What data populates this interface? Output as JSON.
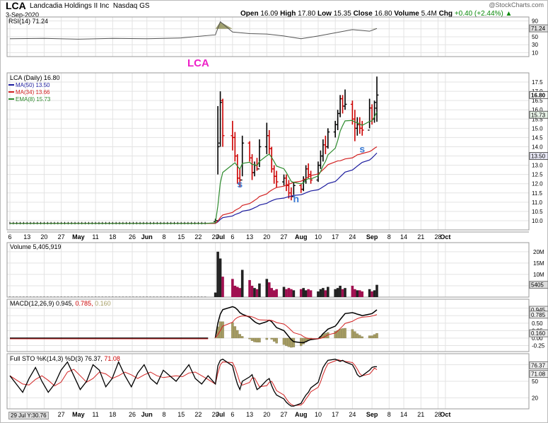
{
  "header": {
    "symbol": "LCA",
    "company": "Landcadia Holdings II Inc",
    "exchange": "Nasdaq GS",
    "date": "3-Sep-2020",
    "watermark": "@StockCharts.com",
    "open_label": "Open",
    "open": "16.09",
    "high_label": "High",
    "high": "17.80",
    "low_label": "Low",
    "low": "15.35",
    "close_label": "Close",
    "close": "16.80",
    "volume_label": "Volume",
    "volume": "5.4M",
    "chg_label": "Chg",
    "chg": "+0.40 (+2.44%)",
    "chg_arrow": "▲"
  },
  "cursor_readout": "29 Jul Y:30.76",
  "colors": {
    "up_bar": "#000000",
    "down_bar": "#cc0000",
    "ma50": "#1b1b9e",
    "ma34": "#d22222",
    "ema8": "#2e8b2e",
    "rsi_fill": "#88884a",
    "macd_hist": "#a59c62",
    "volume_up": "#222222",
    "volume_down": "#a01050",
    "annotation_s": "#3a7bd5",
    "annotation_title": "#ee20c8"
  },
  "chart_data": [
    {
      "type": "line",
      "panel": "rsi",
      "title": "RSI(14) 71.24",
      "y_ticks": [
        90,
        70,
        50,
        30,
        10
      ],
      "ylim": [
        0,
        100
      ],
      "last_value": "71.24",
      "x": [
        "Apr-06",
        "Apr-20",
        "May-04",
        "May-18",
        "Jun-01",
        "Jun-15",
        "Jun-29",
        "Jul-01",
        "Jul-06",
        "Jul-13",
        "Jul-20",
        "Jul-27",
        "Aug-03",
        "Aug-10",
        "Aug-17",
        "Aug-24",
        "Aug-31",
        "Sep-03"
      ],
      "series": [
        {
          "values": [
            45,
            46,
            44,
            46,
            45,
            47,
            55,
            88,
            62,
            58,
            57,
            52,
            45,
            52,
            60,
            68,
            64,
            71
          ]
        }
      ]
    },
    {
      "type": "line",
      "panel": "price",
      "title": "LCA (Daily) 16.80",
      "annotation_title": "LCA",
      "annotations": [
        {
          "text": "s",
          "x": "Jul-09",
          "y": 11.8
        },
        {
          "text": "h",
          "x": "Aug-01",
          "y": 11.0
        },
        {
          "text": "s",
          "x": "Aug-28",
          "y": 13.7
        }
      ],
      "legend": [
        {
          "name": "MA(50) 13.50",
          "color": "#1b1b9e"
        },
        {
          "name": "MA(34) 13.66",
          "color": "#d22222"
        },
        {
          "name": "EMA(8) 15.73",
          "color": "#2e8b2e"
        }
      ],
      "y_ticks": [
        10.0,
        10.5,
        11.0,
        11.5,
        12.0,
        12.5,
        13.0,
        13.5,
        14.0,
        14.5,
        15.0,
        15.5,
        16.0,
        16.5,
        17.0,
        17.5
      ],
      "value_tags": [
        "16.80",
        "15.73",
        "13.50"
      ],
      "ylim": [
        9.5,
        18.0
      ],
      "x_ticks": [
        "6",
        "13",
        "20",
        "27",
        "May",
        "11",
        "18",
        "26",
        "Jun",
        "8",
        "15",
        "22",
        "29",
        "Jul",
        "6",
        "13",
        "20",
        "27",
        "Aug",
        "10",
        "17",
        "24",
        "Sep",
        "8",
        "14",
        "21",
        "28",
        "Oct"
      ],
      "candles_pre": {
        "dates": "Apr-06 to Jun-26",
        "price": 9.85
      },
      "candles": [
        {
          "d": "Jun-29",
          "o": 9.95,
          "h": 10.1,
          "l": 9.9,
          "c": 10.0
        },
        {
          "d": "Jun-30",
          "o": 10.0,
          "h": 16.2,
          "l": 12.5,
          "c": 14.0
        },
        {
          "d": "Jul-01",
          "o": 14.2,
          "h": 17.0,
          "l": 14.0,
          "c": 16.4
        },
        {
          "d": "Jul-02",
          "o": 16.5,
          "h": 16.6,
          "l": 14.0,
          "c": 14.6
        },
        {
          "d": "Jul-06",
          "o": 14.6,
          "h": 15.4,
          "l": 13.8,
          "c": 14.5
        },
        {
          "d": "Jul-07",
          "o": 14.5,
          "h": 14.8,
          "l": 13.2,
          "c": 13.5
        },
        {
          "d": "Jul-08",
          "o": 13.5,
          "h": 13.6,
          "l": 12.0,
          "c": 12.3
        },
        {
          "d": "Jul-09",
          "o": 12.3,
          "h": 12.8,
          "l": 11.8,
          "c": 12.2
        },
        {
          "d": "Jul-10",
          "o": 12.2,
          "h": 14.6,
          "l": 12.4,
          "c": 14.2
        },
        {
          "d": "Jul-13",
          "o": 14.2,
          "h": 14.3,
          "l": 13.2,
          "c": 13.4
        },
        {
          "d": "Jul-14",
          "o": 13.4,
          "h": 13.6,
          "l": 12.2,
          "c": 12.6
        },
        {
          "d": "Jul-15",
          "o": 12.6,
          "h": 13.2,
          "l": 12.4,
          "c": 13.0
        },
        {
          "d": "Jul-16",
          "o": 13.0,
          "h": 13.4,
          "l": 12.7,
          "c": 12.8
        },
        {
          "d": "Jul-17",
          "o": 12.8,
          "h": 14.4,
          "l": 12.9,
          "c": 14.0
        },
        {
          "d": "Jul-20",
          "o": 14.0,
          "h": 15.3,
          "l": 13.6,
          "c": 14.6
        },
        {
          "d": "Jul-21",
          "o": 14.6,
          "h": 14.9,
          "l": 13.6,
          "c": 13.9
        },
        {
          "d": "Jul-22",
          "o": 13.9,
          "h": 14.0,
          "l": 12.6,
          "c": 12.8
        },
        {
          "d": "Jul-23",
          "o": 12.8,
          "h": 13.0,
          "l": 12.0,
          "c": 12.4
        },
        {
          "d": "Jul-24",
          "o": 12.4,
          "h": 12.7,
          "l": 11.8,
          "c": 12.1
        },
        {
          "d": "Jul-27",
          "o": 12.1,
          "h": 12.5,
          "l": 11.9,
          "c": 12.3
        },
        {
          "d": "Jul-28",
          "o": 12.3,
          "h": 12.5,
          "l": 11.6,
          "c": 11.9
        },
        {
          "d": "Jul-29",
          "o": 11.9,
          "h": 12.2,
          "l": 11.2,
          "c": 11.5
        },
        {
          "d": "Jul-30",
          "o": 11.5,
          "h": 11.8,
          "l": 11.1,
          "c": 11.3
        },
        {
          "d": "Jul-31",
          "o": 11.3,
          "h": 12.1,
          "l": 11.4,
          "c": 11.9
        },
        {
          "d": "Aug-03",
          "o": 11.9,
          "h": 12.0,
          "l": 11.5,
          "c": 11.7
        },
        {
          "d": "Aug-04",
          "o": 11.7,
          "h": 12.4,
          "l": 11.6,
          "c": 12.2
        },
        {
          "d": "Aug-05",
          "o": 12.2,
          "h": 13.0,
          "l": 12.0,
          "c": 12.8
        },
        {
          "d": "Aug-06",
          "o": 12.8,
          "h": 13.1,
          "l": 12.3,
          "c": 12.5
        },
        {
          "d": "Aug-07",
          "o": 12.5,
          "h": 12.7,
          "l": 12.0,
          "c": 12.2
        },
        {
          "d": "Aug-10",
          "o": 12.2,
          "h": 13.2,
          "l": 12.1,
          "c": 13.0
        },
        {
          "d": "Aug-11",
          "o": 13.0,
          "h": 13.8,
          "l": 12.8,
          "c": 13.5
        },
        {
          "d": "Aug-12",
          "o": 13.5,
          "h": 14.4,
          "l": 13.2,
          "c": 14.1
        },
        {
          "d": "Aug-13",
          "o": 14.1,
          "h": 14.6,
          "l": 13.6,
          "c": 14.0
        },
        {
          "d": "Aug-14",
          "o": 14.0,
          "h": 15.0,
          "l": 13.9,
          "c": 14.8
        },
        {
          "d": "Aug-17",
          "o": 14.8,
          "h": 15.4,
          "l": 14.5,
          "c": 15.2
        },
        {
          "d": "Aug-18",
          "o": 15.2,
          "h": 16.0,
          "l": 14.9,
          "c": 15.8
        },
        {
          "d": "Aug-19",
          "o": 15.8,
          "h": 16.8,
          "l": 15.6,
          "c": 16.6
        },
        {
          "d": "Aug-20",
          "o": 16.6,
          "h": 16.8,
          "l": 15.8,
          "c": 16.2
        },
        {
          "d": "Aug-21",
          "o": 16.2,
          "h": 17.1,
          "l": 16.0,
          "c": 16.3
        },
        {
          "d": "Aug-24",
          "o": 16.3,
          "h": 16.5,
          "l": 15.2,
          "c": 15.5
        },
        {
          "d": "Aug-25",
          "o": 15.5,
          "h": 16.0,
          "l": 14.3,
          "c": 15.0
        },
        {
          "d": "Aug-26",
          "o": 15.0,
          "h": 15.6,
          "l": 14.6,
          "c": 15.2
        },
        {
          "d": "Aug-27",
          "o": 15.2,
          "h": 15.6,
          "l": 14.7,
          "c": 15.0
        },
        {
          "d": "Aug-28",
          "o": 15.0,
          "h": 15.4,
          "l": 14.6,
          "c": 14.9
        },
        {
          "d": "Aug-31",
          "o": 14.9,
          "h": 16.6,
          "l": 15.0,
          "c": 16.1
        },
        {
          "d": "Sep-01",
          "o": 16.1,
          "h": 16.3,
          "l": 15.2,
          "c": 15.5
        },
        {
          "d": "Sep-02",
          "o": 15.5,
          "h": 16.5,
          "l": 15.3,
          "c": 16.4
        },
        {
          "d": "Sep-03",
          "o": 16.09,
          "h": 17.8,
          "l": 15.35,
          "c": 16.8
        }
      ]
    },
    {
      "type": "bar",
      "panel": "volume",
      "title": "Volume 5,405,919",
      "y_ticks": [
        "20M",
        "15M",
        "10M",
        "5M"
      ],
      "value_tag": "5405",
      "ylim": [
        0,
        24000000
      ],
      "pre_volume": 150000,
      "values": [
        2000000,
        20000000,
        17000000,
        9000000,
        8000000,
        5000000,
        4500000,
        4000000,
        12000000,
        7500000,
        5000000,
        4000000,
        3500000,
        6000000,
        8000000,
        6500000,
        4000000,
        3000000,
        3500000,
        4500000,
        3500000,
        4000000,
        3500000,
        3000000,
        3500000,
        4000000,
        3000000,
        3500000,
        3000000,
        2500000,
        3500000,
        4000000,
        3000000,
        4500000,
        3500000,
        4000000,
        5000000,
        3500000,
        4000000,
        5000000,
        3500000,
        3000000,
        3000000,
        2500000,
        3500000,
        2500000,
        3000000,
        5400000
      ]
    },
    {
      "type": "line",
      "panel": "macd",
      "title": "MACD(12,26,9) 0.945, 0.785, 0.160",
      "y_ticks": [
        "1.00",
        "0.75",
        "0.50",
        "0.25",
        "0.00",
        "-0.25"
      ],
      "value_tags": [
        "0.945",
        "0.785",
        "0.160"
      ],
      "ylim": [
        -0.45,
        1.3
      ],
      "series": [
        {
          "name": "MACD",
          "values": [
            0.02,
            0.5,
            0.8,
            0.95,
            1.05,
            1.02,
            0.95,
            0.85,
            0.8,
            0.7,
            0.62,
            0.55,
            0.5,
            0.47,
            0.55,
            0.6,
            0.55,
            0.45,
            0.35,
            0.25,
            0.15,
            0.05,
            -0.05,
            -0.12,
            -0.15,
            -0.15,
            -0.12,
            -0.08,
            -0.05,
            -0.02,
            0.05,
            0.15,
            0.22,
            0.3,
            0.4,
            0.5,
            0.62,
            0.72,
            0.82,
            0.85,
            0.83,
            0.8,
            0.78,
            0.75,
            0.8,
            0.82,
            0.88,
            0.945
          ]
        },
        {
          "name": "Signal",
          "values": [
            0.01,
            0.12,
            0.25,
            0.4,
            0.53,
            0.63,
            0.69,
            0.72,
            0.74,
            0.73,
            0.71,
            0.68,
            0.64,
            0.61,
            0.6,
            0.6,
            0.59,
            0.56,
            0.52,
            0.47,
            0.41,
            0.34,
            0.26,
            0.18,
            0.11,
            0.05,
            0.01,
            -0.01,
            -0.02,
            -0.02,
            -0.01,
            0.02,
            0.06,
            0.11,
            0.17,
            0.24,
            0.32,
            0.4,
            0.49,
            0.56,
            0.61,
            0.65,
            0.68,
            0.7,
            0.72,
            0.74,
            0.76,
            0.785
          ]
        }
      ]
    },
    {
      "type": "line",
      "panel": "stochastic",
      "title": "Full STO %K(14,3) %D(3) 76.37, 71.08",
      "y_ticks": [
        "80",
        "50",
        "20"
      ],
      "value_tags": [
        "76.37",
        "71.08"
      ],
      "ylim": [
        0,
        100
      ],
      "pre_k": [
        60,
        45,
        30,
        55,
        75,
        50,
        30,
        45,
        70,
        85,
        60,
        35,
        50,
        80,
        70,
        40,
        55,
        85,
        60,
        40,
        65,
        80,
        55,
        45,
        70,
        60,
        50,
        65,
        80,
        55,
        45,
        60
      ],
      "series": [
        {
          "name": "%K",
          "values": [
            45,
            78,
            88,
            90,
            78,
            60,
            45,
            35,
            50,
            58,
            62,
            48,
            35,
            38,
            52,
            55,
            42,
            32,
            25,
            18,
            12,
            8,
            5,
            5,
            10,
            18,
            25,
            30,
            38,
            48,
            62,
            75,
            82,
            88,
            90,
            88,
            86,
            88,
            85,
            80,
            72,
            62,
            58,
            60,
            70,
            75,
            76.37,
            76.37
          ]
        },
        {
          "name": "%D",
          "values": [
            45,
            65,
            80,
            85,
            84,
            75,
            62,
            48,
            43,
            48,
            56,
            56,
            48,
            40,
            42,
            48,
            50,
            42,
            33,
            25,
            18,
            12,
            8,
            6,
            7,
            11,
            18,
            24,
            31,
            39,
            49,
            62,
            73,
            82,
            87,
            89,
            88,
            87,
            86,
            84,
            79,
            72,
            64,
            60,
            63,
            68,
            74,
            71.08
          ]
        }
      ]
    }
  ],
  "x_axis": {
    "labels": [
      {
        "t": "6",
        "d": "Apr-06"
      },
      {
        "t": "13",
        "d": "Apr-13"
      },
      {
        "t": "20",
        "d": "Apr-20"
      },
      {
        "t": "27",
        "d": "Apr-27"
      },
      {
        "t": "May",
        "d": "May-04",
        "b": true
      },
      {
        "t": "11",
        "d": "May-11"
      },
      {
        "t": "18",
        "d": "May-18"
      },
      {
        "t": "26",
        "d": "May-26"
      },
      {
        "t": "Jun",
        "d": "Jun-01",
        "b": true
      },
      {
        "t": "8",
        "d": "Jun-08"
      },
      {
        "t": "15",
        "d": "Jun-15"
      },
      {
        "t": "22",
        "d": "Jun-22"
      },
      {
        "t": "29",
        "d": "Jun-29"
      },
      {
        "t": "Jul",
        "d": "Jul-01",
        "b": true
      },
      {
        "t": "6",
        "d": "Jul-06"
      },
      {
        "t": "13",
        "d": "Jul-13"
      },
      {
        "t": "20",
        "d": "Jul-20"
      },
      {
        "t": "27",
        "d": "Jul-27"
      },
      {
        "t": "Aug",
        "d": "Aug-03",
        "b": true
      },
      {
        "t": "10",
        "d": "Aug-10"
      },
      {
        "t": "17",
        "d": "Aug-17"
      },
      {
        "t": "24",
        "d": "Aug-24"
      },
      {
        "t": "Sep",
        "d": "Sep-01",
        "b": true
      },
      {
        "t": "8",
        "d": "Sep-08"
      },
      {
        "t": "14",
        "d": "Sep-14"
      },
      {
        "t": "21",
        "d": "Sep-21"
      },
      {
        "t": "28",
        "d": "Sep-28"
      },
      {
        "t": "Oct",
        "d": "Oct-01",
        "b": true
      }
    ]
  }
}
